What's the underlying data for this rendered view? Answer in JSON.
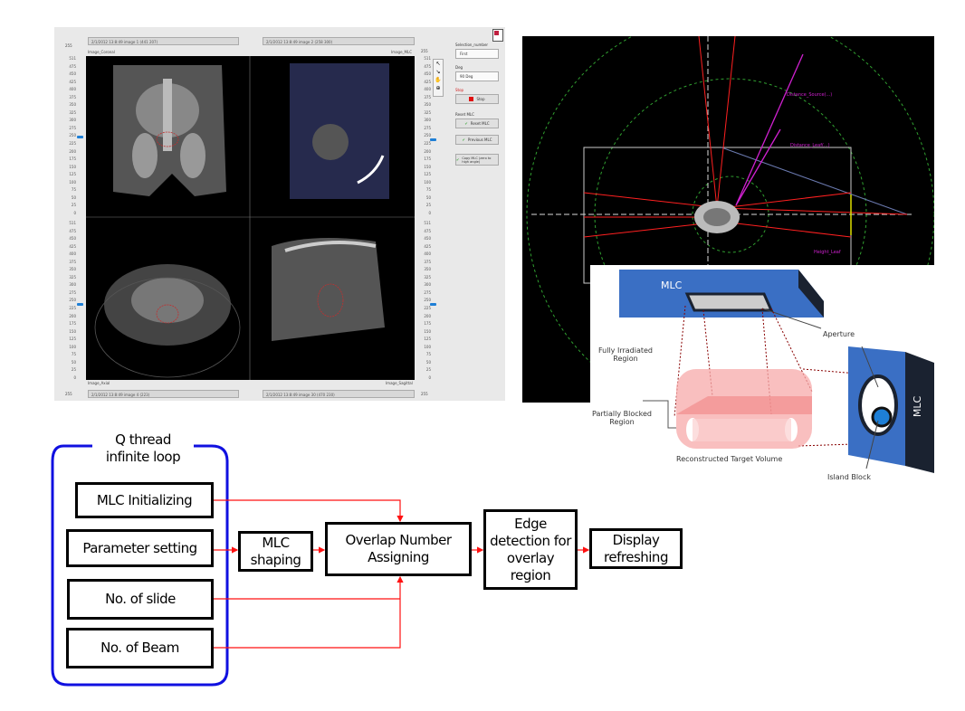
{
  "software_panel": {
    "views": {
      "coronal": {
        "combo": "2/1/2012 13:8:49 image 1 (441 207)",
        "label": "Image_Coronal",
        "spinner": "255"
      },
      "mlc": {
        "combo": "2/1/2012 13:8:49 image 2 (258 300)",
        "label": "Image_MLC",
        "spinner": "255"
      },
      "axial": {
        "combo": "2/1/2012 13:8:49 image 4 (223)",
        "label": "Image_Axial",
        "spinner": "255"
      },
      "sagittal": {
        "combo": "2/1/2012 13:8:49 image 30 (470 230)",
        "label": "Image_Sagittal",
        "spinner": "255"
      }
    },
    "ruler_ticks": [
      "511",
      "475",
      "450",
      "425",
      "400",
      "375",
      "350",
      "325",
      "300",
      "275",
      "250",
      "225",
      "200",
      "175",
      "150",
      "125",
      "100",
      "75",
      "50",
      "25",
      "0"
    ],
    "controls": {
      "selection_label": "Selection_number",
      "selection_value": "First",
      "deg_label": "Deg",
      "deg_value": "90 Deg",
      "stop_label": "Stop",
      "stop_button": "Stop",
      "reset_group_label": "Reset MLC",
      "reset_button": "Reset MLC",
      "previous_button": "Previous MLC",
      "copy_button": "Copy MLC (zero to high angle)"
    },
    "colors": {
      "accent": "#1e7fd6",
      "stop": "#e01010",
      "check": "#3aa83a"
    }
  },
  "beam_view": {
    "labels": {
      "distance_source": "Distance_Source(...)",
      "distance_leaf": "Distance_Leaf(...)",
      "height_leaf": "Height_Leaf"
    },
    "colors": {
      "background": "#000000",
      "beam": "#ff2020",
      "guide": "#d020d0",
      "circle": "#30a030",
      "height": "#e0e000"
    }
  },
  "mlc_diagram": {
    "mlc_top": "MLC",
    "mlc_side": "MLC",
    "aperture": "Aperture",
    "fully_irradiated": "Fully Irradiated Region",
    "partially_blocked": "Partially Blocked Region",
    "target_volume": "Reconstructed Target Volume",
    "island_block": "Island Block",
    "colors": {
      "mlc": "#3a6fc4",
      "target": "#f7a9a9"
    }
  },
  "flowchart": {
    "loop_title_1": "Q thread",
    "loop_title_2": "infinite loop",
    "inputs": [
      "MLC Initializing",
      "Parameter setting",
      "No. of slide",
      "No. of Beam"
    ],
    "mlc_shaping": "MLC shaping",
    "overlap": "Overlap Number Assigning",
    "edge": "Edge detection for overlay region",
    "display": "Display refreshing",
    "colors": {
      "loop": "#1010e0",
      "arrow": "#ff1010"
    }
  }
}
